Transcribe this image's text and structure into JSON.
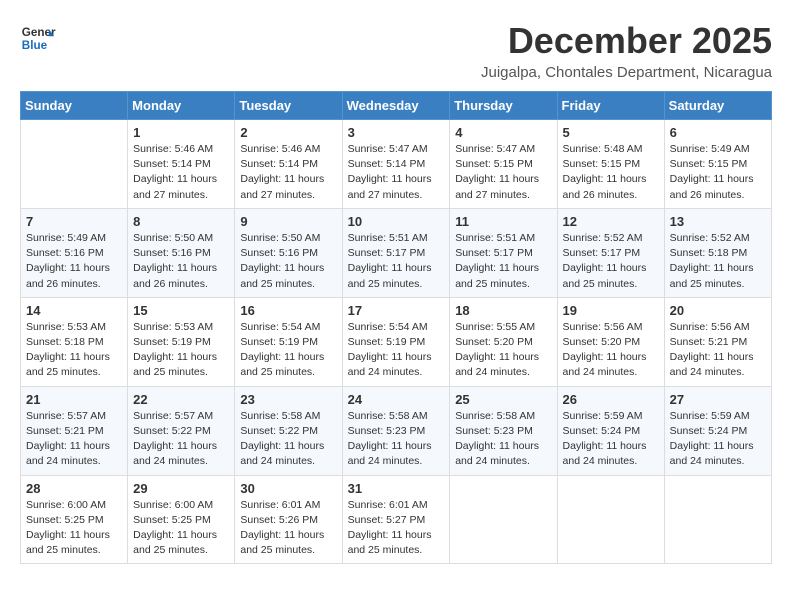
{
  "logo": {
    "general": "General",
    "blue": "Blue"
  },
  "title": "December 2025",
  "subtitle": "Juigalpa, Chontales Department, Nicaragua",
  "header": {
    "days": [
      "Sunday",
      "Monday",
      "Tuesday",
      "Wednesday",
      "Thursday",
      "Friday",
      "Saturday"
    ]
  },
  "weeks": [
    [
      {
        "day": "",
        "info": ""
      },
      {
        "day": "1",
        "info": "Sunrise: 5:46 AM\nSunset: 5:14 PM\nDaylight: 11 hours\nand 27 minutes."
      },
      {
        "day": "2",
        "info": "Sunrise: 5:46 AM\nSunset: 5:14 PM\nDaylight: 11 hours\nand 27 minutes."
      },
      {
        "day": "3",
        "info": "Sunrise: 5:47 AM\nSunset: 5:14 PM\nDaylight: 11 hours\nand 27 minutes."
      },
      {
        "day": "4",
        "info": "Sunrise: 5:47 AM\nSunset: 5:15 PM\nDaylight: 11 hours\nand 27 minutes."
      },
      {
        "day": "5",
        "info": "Sunrise: 5:48 AM\nSunset: 5:15 PM\nDaylight: 11 hours\nand 26 minutes."
      },
      {
        "day": "6",
        "info": "Sunrise: 5:49 AM\nSunset: 5:15 PM\nDaylight: 11 hours\nand 26 minutes."
      }
    ],
    [
      {
        "day": "7",
        "info": "Sunrise: 5:49 AM\nSunset: 5:16 PM\nDaylight: 11 hours\nand 26 minutes."
      },
      {
        "day": "8",
        "info": "Sunrise: 5:50 AM\nSunset: 5:16 PM\nDaylight: 11 hours\nand 26 minutes."
      },
      {
        "day": "9",
        "info": "Sunrise: 5:50 AM\nSunset: 5:16 PM\nDaylight: 11 hours\nand 25 minutes."
      },
      {
        "day": "10",
        "info": "Sunrise: 5:51 AM\nSunset: 5:17 PM\nDaylight: 11 hours\nand 25 minutes."
      },
      {
        "day": "11",
        "info": "Sunrise: 5:51 AM\nSunset: 5:17 PM\nDaylight: 11 hours\nand 25 minutes."
      },
      {
        "day": "12",
        "info": "Sunrise: 5:52 AM\nSunset: 5:17 PM\nDaylight: 11 hours\nand 25 minutes."
      },
      {
        "day": "13",
        "info": "Sunrise: 5:52 AM\nSunset: 5:18 PM\nDaylight: 11 hours\nand 25 minutes."
      }
    ],
    [
      {
        "day": "14",
        "info": "Sunrise: 5:53 AM\nSunset: 5:18 PM\nDaylight: 11 hours\nand 25 minutes."
      },
      {
        "day": "15",
        "info": "Sunrise: 5:53 AM\nSunset: 5:19 PM\nDaylight: 11 hours\nand 25 minutes."
      },
      {
        "day": "16",
        "info": "Sunrise: 5:54 AM\nSunset: 5:19 PM\nDaylight: 11 hours\nand 25 minutes."
      },
      {
        "day": "17",
        "info": "Sunrise: 5:54 AM\nSunset: 5:19 PM\nDaylight: 11 hours\nand 24 minutes."
      },
      {
        "day": "18",
        "info": "Sunrise: 5:55 AM\nSunset: 5:20 PM\nDaylight: 11 hours\nand 24 minutes."
      },
      {
        "day": "19",
        "info": "Sunrise: 5:56 AM\nSunset: 5:20 PM\nDaylight: 11 hours\nand 24 minutes."
      },
      {
        "day": "20",
        "info": "Sunrise: 5:56 AM\nSunset: 5:21 PM\nDaylight: 11 hours\nand 24 minutes."
      }
    ],
    [
      {
        "day": "21",
        "info": "Sunrise: 5:57 AM\nSunset: 5:21 PM\nDaylight: 11 hours\nand 24 minutes."
      },
      {
        "day": "22",
        "info": "Sunrise: 5:57 AM\nSunset: 5:22 PM\nDaylight: 11 hours\nand 24 minutes."
      },
      {
        "day": "23",
        "info": "Sunrise: 5:58 AM\nSunset: 5:22 PM\nDaylight: 11 hours\nand 24 minutes."
      },
      {
        "day": "24",
        "info": "Sunrise: 5:58 AM\nSunset: 5:23 PM\nDaylight: 11 hours\nand 24 minutes."
      },
      {
        "day": "25",
        "info": "Sunrise: 5:58 AM\nSunset: 5:23 PM\nDaylight: 11 hours\nand 24 minutes."
      },
      {
        "day": "26",
        "info": "Sunrise: 5:59 AM\nSunset: 5:24 PM\nDaylight: 11 hours\nand 24 minutes."
      },
      {
        "day": "27",
        "info": "Sunrise: 5:59 AM\nSunset: 5:24 PM\nDaylight: 11 hours\nand 24 minutes."
      }
    ],
    [
      {
        "day": "28",
        "info": "Sunrise: 6:00 AM\nSunset: 5:25 PM\nDaylight: 11 hours\nand 25 minutes."
      },
      {
        "day": "29",
        "info": "Sunrise: 6:00 AM\nSunset: 5:25 PM\nDaylight: 11 hours\nand 25 minutes."
      },
      {
        "day": "30",
        "info": "Sunrise: 6:01 AM\nSunset: 5:26 PM\nDaylight: 11 hours\nand 25 minutes."
      },
      {
        "day": "31",
        "info": "Sunrise: 6:01 AM\nSunset: 5:27 PM\nDaylight: 11 hours\nand 25 minutes."
      },
      {
        "day": "",
        "info": ""
      },
      {
        "day": "",
        "info": ""
      },
      {
        "day": "",
        "info": ""
      }
    ]
  ]
}
